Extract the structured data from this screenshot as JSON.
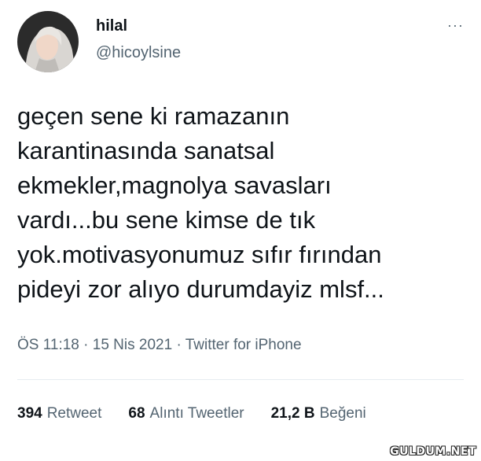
{
  "author": {
    "display_name": "hilal",
    "handle": "@hicoylsine",
    "avatar_icon": "profile-photo-icon"
  },
  "more_icon": "ellipsis-icon",
  "more_label": "···",
  "tweet": {
    "text": "geçen sene ki ramazanın\nkarantinasında sanatsal\nekmekler,magnolya savasları\nvardı...bu sene kimse de tık\nyok.motivasyonumuz sıfır fırından\npideyi zor alıyo durumdayiz mlsf..."
  },
  "meta": {
    "time": "ÖS 11:18",
    "separator": " · ",
    "date": "15 Nis 2021",
    "source": "Twitter for iPhone"
  },
  "stats": {
    "retweets": {
      "count": "394",
      "label": "Retweet"
    },
    "quotes": {
      "count": "68",
      "label": "Alıntı Tweetler"
    },
    "likes": {
      "count": "21,2 B",
      "label": "Beğeni"
    }
  },
  "watermark": "GULDUM.NET",
  "colors": {
    "text": "#0f1419",
    "secondary": "#536471",
    "divider": "#e6ecf0"
  }
}
